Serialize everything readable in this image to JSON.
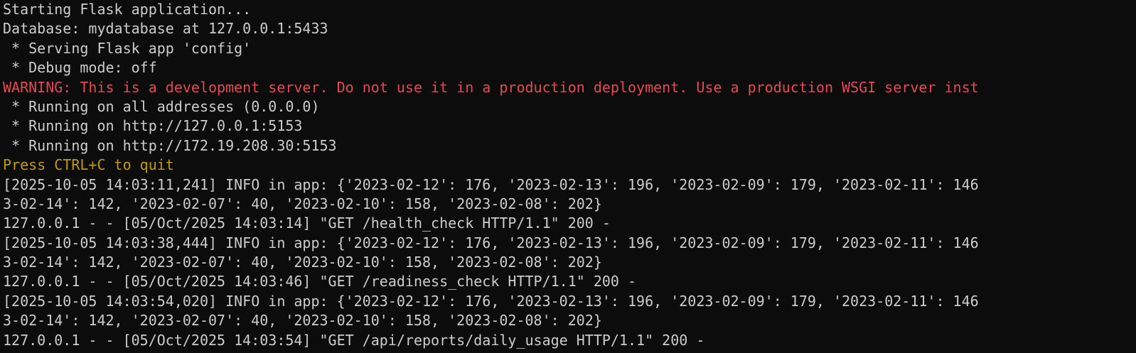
{
  "terminal": {
    "colors": {
      "background": "#0c0c0c",
      "default_text": "#cccccc",
      "warning_text": "#e74856",
      "notice_text": "#c19c00"
    },
    "lines": [
      {
        "text": "Starting Flask application...",
        "kind": "normal"
      },
      {
        "text": "Database: mydatabase at 127.0.0.1:5433",
        "kind": "normal"
      },
      {
        "text": " * Serving Flask app 'config'",
        "kind": "normal"
      },
      {
        "text": " * Debug mode: off",
        "kind": "normal"
      },
      {
        "text": "WARNING: This is a development server. Do not use it in a production deployment. Use a production WSGI server inst",
        "kind": "warning"
      },
      {
        "text": " * Running on all addresses (0.0.0.0)",
        "kind": "normal"
      },
      {
        "text": " * Running on http://127.0.0.1:5153",
        "kind": "normal"
      },
      {
        "text": " * Running on http://172.19.208.30:5153",
        "kind": "normal"
      },
      {
        "text": "Press CTRL+C to quit",
        "kind": "notice"
      },
      {
        "text": "[2025-10-05 14:03:11,241] INFO in app: {'2023-02-12': 176, '2023-02-13': 196, '2023-02-09': 179, '2023-02-11': 146",
        "kind": "normal"
      },
      {
        "text": "3-02-14': 142, '2023-02-07': 40, '2023-02-10': 158, '2023-02-08': 202}",
        "kind": "normal"
      },
      {
        "text": "127.0.0.1 - - [05/Oct/2025 14:03:14] \"GET /health_check HTTP/1.1\" 200 -",
        "kind": "normal"
      },
      {
        "text": "[2025-10-05 14:03:38,444] INFO in app: {'2023-02-12': 176, '2023-02-13': 196, '2023-02-09': 179, '2023-02-11': 146",
        "kind": "normal"
      },
      {
        "text": "3-02-14': 142, '2023-02-07': 40, '2023-02-10': 158, '2023-02-08': 202}",
        "kind": "normal"
      },
      {
        "text": "127.0.0.1 - - [05/Oct/2025 14:03:46] \"GET /readiness_check HTTP/1.1\" 200 -",
        "kind": "normal"
      },
      {
        "text": "[2025-10-05 14:03:54,020] INFO in app: {'2023-02-12': 176, '2023-02-13': 196, '2023-02-09': 179, '2023-02-11': 146",
        "kind": "normal"
      },
      {
        "text": "3-02-14': 142, '2023-02-07': 40, '2023-02-10': 158, '2023-02-08': 202}",
        "kind": "normal"
      },
      {
        "text": "127.0.0.1 - - [05/Oct/2025 14:03:54] \"GET /api/reports/daily_usage HTTP/1.1\" 200 -",
        "kind": "normal"
      }
    ]
  }
}
